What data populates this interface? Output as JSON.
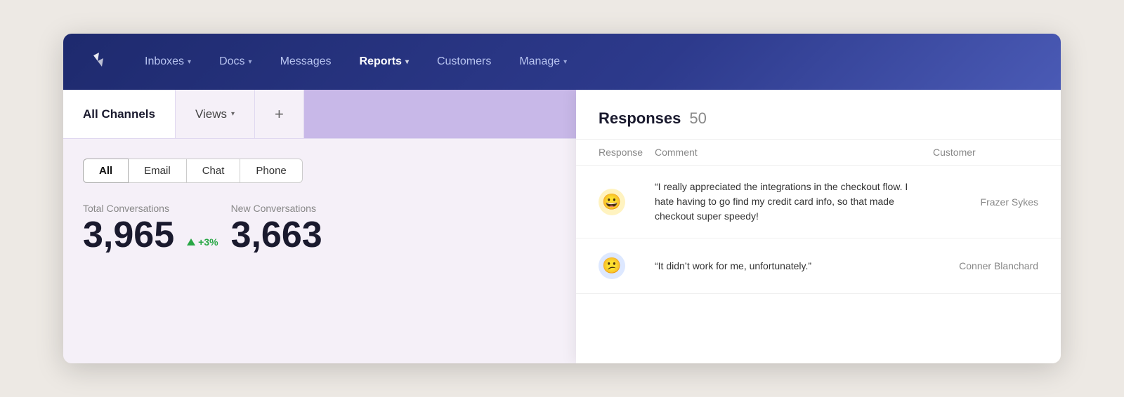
{
  "navbar": {
    "logo_label": "Logo",
    "items": [
      {
        "id": "inboxes",
        "label": "Inboxes",
        "hasDropdown": true,
        "active": false
      },
      {
        "id": "docs",
        "label": "Docs",
        "hasDropdown": true,
        "active": false
      },
      {
        "id": "messages",
        "label": "Messages",
        "hasDropdown": false,
        "active": false
      },
      {
        "id": "reports",
        "label": "Reports",
        "hasDropdown": true,
        "active": true
      },
      {
        "id": "customers",
        "label": "Customers",
        "hasDropdown": false,
        "active": false
      },
      {
        "id": "manage",
        "label": "Manage",
        "hasDropdown": true,
        "active": false
      }
    ]
  },
  "subnav": {
    "channels_label": "All Channels",
    "views_label": "Views",
    "plus_label": "+"
  },
  "filters": {
    "tabs": [
      {
        "id": "all",
        "label": "All",
        "active": true
      },
      {
        "id": "email",
        "label": "Email",
        "active": false
      },
      {
        "id": "chat",
        "label": "Chat",
        "active": false
      },
      {
        "id": "phone",
        "label": "Phone",
        "active": false
      }
    ]
  },
  "stats": {
    "total_label": "Total Conversations",
    "total_value": "3,965",
    "badge_text": "+3%",
    "new_label": "New Conversations",
    "new_value": "3,663"
  },
  "responses": {
    "title": "Responses",
    "count": "50",
    "columns": {
      "response": "Response",
      "comment": "Comment",
      "customer": "Customer"
    },
    "rows": [
      {
        "emoji": "😀",
        "emoji_bg": "#fff3b0",
        "comment": "“I really appreciated the integrations in the checkout flow. I hate having to go find my credit card info, so that made checkout super speedy!",
        "customer": "Frazer Sykes"
      },
      {
        "emoji": "😕",
        "emoji_bg": "#dde8ff",
        "comment": "“It didn’t work for me, unfortunately.”",
        "customer": "Conner Blanchard"
      }
    ]
  }
}
